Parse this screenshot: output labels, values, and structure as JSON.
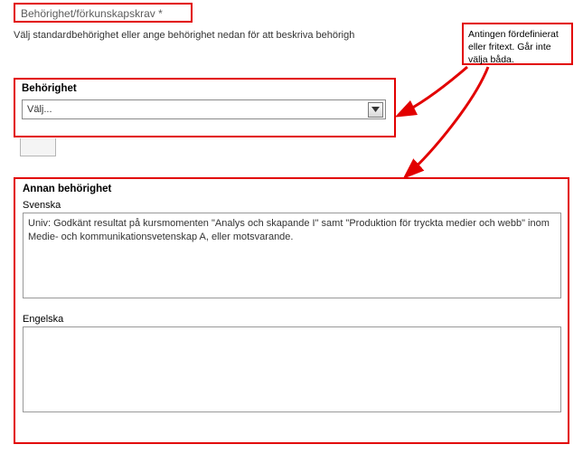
{
  "header": {
    "title": "Behörighet/förkunskapskrav *",
    "desc": "Välj standardbehörighet eller ange behörighet nedan för att beskriva behörigh"
  },
  "callout": {
    "text": "Antingen fördefinierat eller fritext. Går inte välja båda."
  },
  "behorighet": {
    "title": "Behörighet",
    "selected": "Välj..."
  },
  "annan": {
    "title": "Annan behörighet",
    "svenska_label": "Svenska",
    "svenska_value": "Univ: Godkänt resultat på kursmomenten \"Analys och skapande I\" samt \"Produktion för tryckta medier och webb\" inom Medie- och kommunikationsvetenskap A, eller motsvarande.",
    "engelska_label": "Engelska",
    "engelska_value": ""
  }
}
